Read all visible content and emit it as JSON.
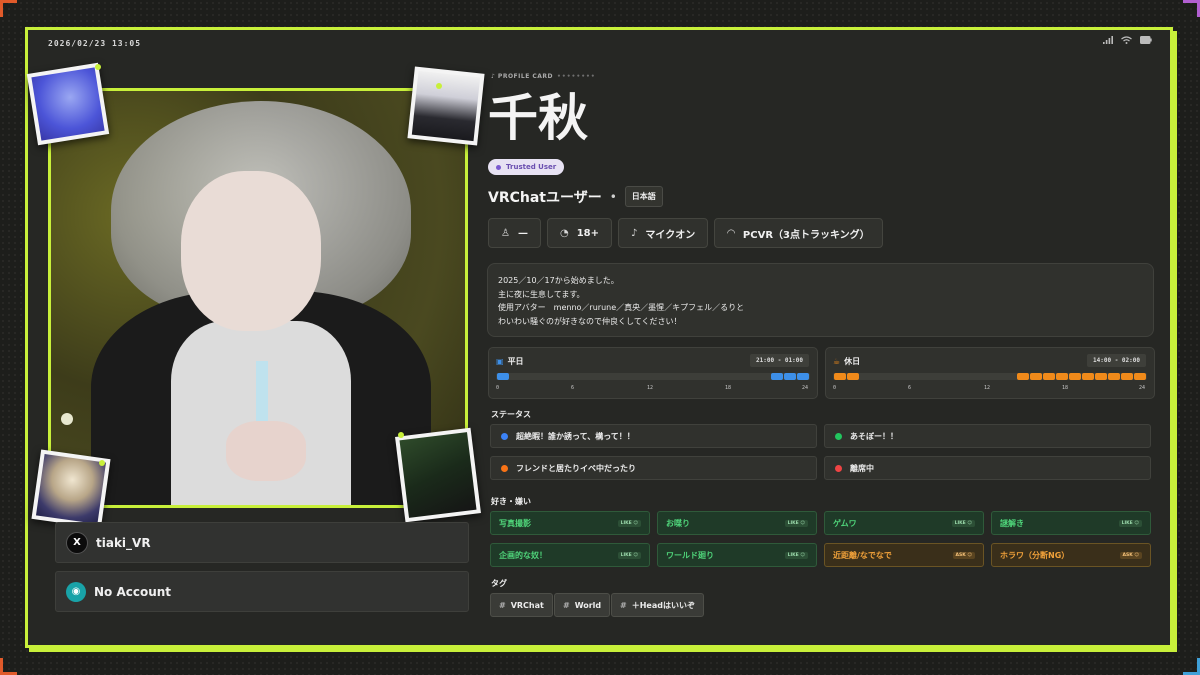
{
  "statusbar": {
    "time": "2026/02/23 13:05"
  },
  "card_label": "PROFILE CARD",
  "name": "千秋",
  "trusted_badge": "Trusted User",
  "user_type": "VRChatユーザー",
  "separator": "•",
  "language": "日本語",
  "chips": [
    {
      "icon": "person-icon",
      "glyph": "♙",
      "label": "—"
    },
    {
      "icon": "age-icon",
      "glyph": "◔",
      "label": "18+"
    },
    {
      "icon": "microphone-icon",
      "glyph": "♪",
      "label": "マイクオン"
    },
    {
      "icon": "headset-icon",
      "glyph": "◠",
      "label": "PCVR（3点トラッキング）"
    }
  ],
  "bio": [
    "2025／10／17から始めました。",
    "主に夜に生息してます。",
    "使用アバター　menno／rurune／真央／墨惺／キプフェル／るりと",
    "わいわい騒ぐのが好きなので仲良くしてください！"
  ],
  "schedule": {
    "weekday": {
      "label": "平日",
      "range": "21:00 - 01:00",
      "active_hours": [
        0,
        21,
        22,
        23
      ]
    },
    "holiday": {
      "label": "休日",
      "range": "14:00 - 02:00",
      "active_hours": [
        0,
        1,
        14,
        15,
        16,
        17,
        18,
        19,
        20,
        21,
        22,
        23
      ]
    },
    "ticks": [
      "0",
      "6",
      "12",
      "18",
      "24"
    ]
  },
  "status_title": "ステータス",
  "statuses": [
    {
      "label": "超絶暇！誰か誘って、構って！！",
      "color": "#3b82f6"
    },
    {
      "label": "あそぼー！！",
      "color": "#22c55e"
    },
    {
      "label": "フレンドと居たりイベ中だったり",
      "color": "#f97316"
    },
    {
      "label": "離席中",
      "color": "#ef4444"
    }
  ],
  "prefs_title": "好き・嫌い",
  "prefs": [
    {
      "label": "写真撮影",
      "badge": "LIKE ☺",
      "kind": "like"
    },
    {
      "label": "お喋り",
      "badge": "LIKE ☺",
      "kind": "like"
    },
    {
      "label": "ゲムワ",
      "badge": "LIKE ☺",
      "kind": "like"
    },
    {
      "label": "謎解き",
      "badge": "LIKE ☺",
      "kind": "like"
    },
    {
      "label": "企画的な奴！",
      "badge": "LIKE ☺",
      "kind": "like"
    },
    {
      "label": "ワールド廻り",
      "badge": "LIKE ☺",
      "kind": "like"
    },
    {
      "label": "近距離/なでなで",
      "badge": "ASK ☺",
      "kind": "ask"
    },
    {
      "label": "ホラワ（分断NG）",
      "badge": "ASK ☺",
      "kind": "ask"
    }
  ],
  "tags_title": "タグ",
  "tags": [
    "VRChat",
    "World",
    "＋Headはいいぞ"
  ],
  "socials": [
    {
      "icon": "x-logo-icon",
      "glyph": "X",
      "label": "tiaki_VR"
    },
    {
      "icon": "discord-icon",
      "glyph": "◉",
      "label": "No Account"
    }
  ]
}
